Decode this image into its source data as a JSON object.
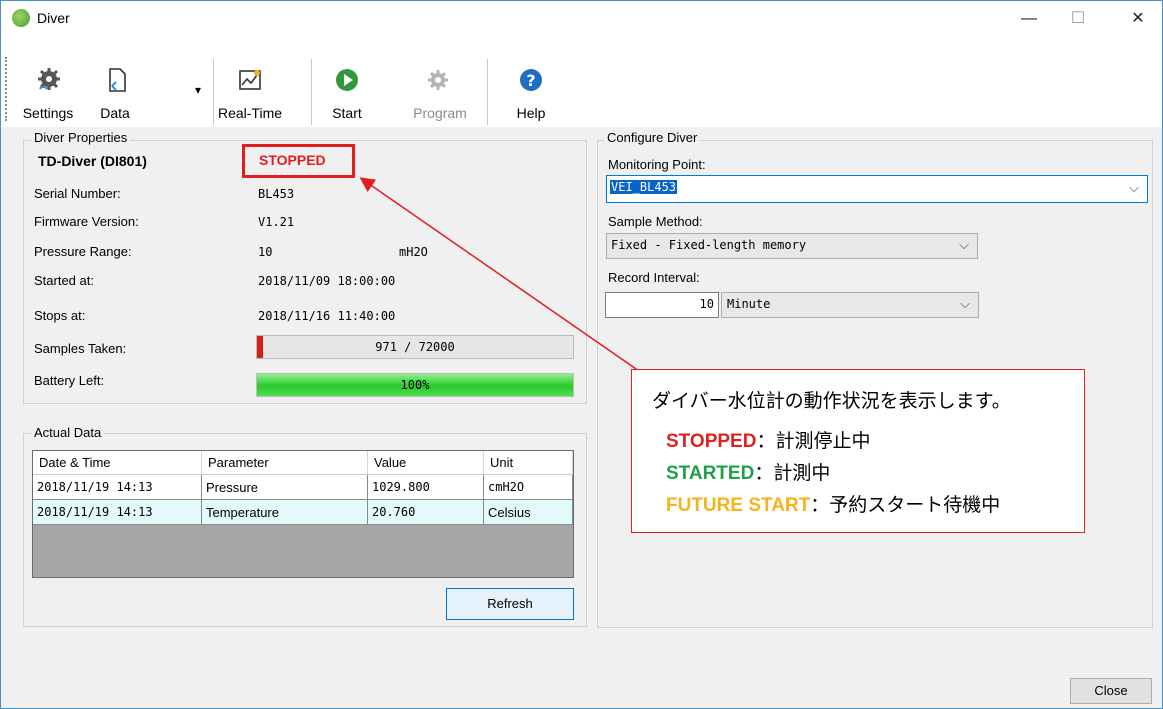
{
  "window": {
    "title": "Diver",
    "minimize": "—",
    "maximize": "☐",
    "close": "✕"
  },
  "toolbar": {
    "settings": "Settings",
    "data": "Data",
    "data_dropdown": "▾",
    "realtime": "Real-Time",
    "start": "Start",
    "program": "Program",
    "help": "Help"
  },
  "properties": {
    "group_title": "Diver Properties",
    "device_name": "TD-Diver (DI801)",
    "status": "STOPPED",
    "serial_label": "Serial Number:",
    "serial_value": "BL453",
    "firmware_label": "Firmware Version:",
    "firmware_value": "V1.21",
    "pressure_label": "Pressure Range:",
    "pressure_value": "10",
    "pressure_unit": "mH2O",
    "started_label": "Started at:",
    "started_value": "2018/11/09 18:00:00",
    "stops_label": "Stops at:",
    "stops_value": "2018/11/16 11:40:00",
    "samples_label": "Samples Taken:",
    "samples_text": "971 / 72000",
    "samples_taken": 971,
    "samples_total": 72000,
    "battery_label": "Battery Left:",
    "battery_text": "100%",
    "battery_fraction": 1.0
  },
  "actual_data": {
    "group_title": "Actual Data",
    "columns": [
      "Date & Time",
      "Parameter",
      "Value",
      "Unit"
    ],
    "rows": [
      [
        "2018/11/19 14:13",
        "Pressure",
        "1029.800",
        "cmH2O"
      ],
      [
        "2018/11/19 14:13",
        "Temperature",
        "20.760",
        "Celsius"
      ]
    ],
    "refresh": "Refresh"
  },
  "configure": {
    "group_title": "Configure Diver",
    "monitoring_label": "Monitoring Point:",
    "monitoring_value": "VEI_BL453",
    "method_label": "Sample Method:",
    "method_value": "Fixed - Fixed-length memory",
    "interval_label": "Record Interval:",
    "interval_value": "10",
    "interval_unit": "Minute"
  },
  "annotation": {
    "line1": "ダイバー水位計の動作状況を表示します。",
    "stopped_key": "STOPPED",
    "stopped_desc": "：計測停止中",
    "started_key": "STARTED",
    "started_desc": "：計測中",
    "future_key": "FUTURE START",
    "future_desc": "：予約スタート待機中"
  },
  "footer": {
    "close": "Close"
  },
  "colors": {
    "stopped": "#e02020",
    "started": "#1fa04a",
    "future": "#f5b31c",
    "battery": "#3fd83f",
    "selection": "#0a64c8"
  }
}
